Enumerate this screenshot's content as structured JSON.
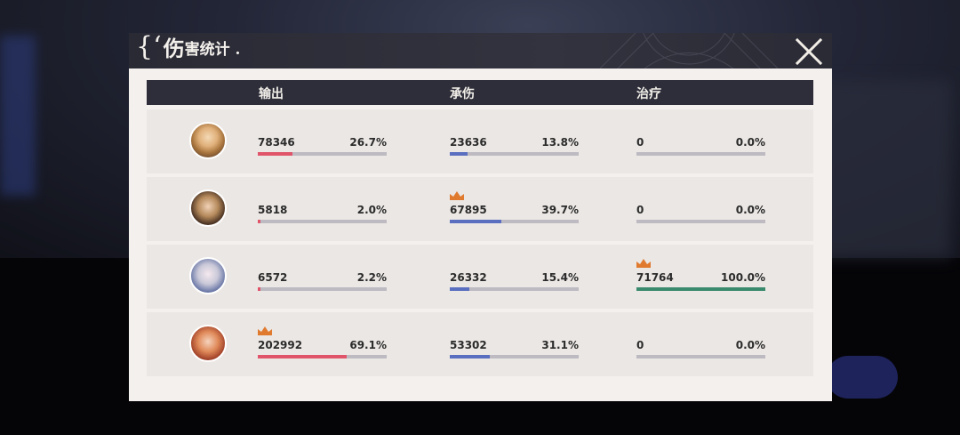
{
  "window": {
    "title_brace": "{‘",
    "title_big": "伤",
    "title_rest": "害统计 ."
  },
  "columns": [
    "输出",
    "承伤",
    "治疗"
  ],
  "colors": {
    "output": "#e0556a",
    "damage_taken": "#5a6fc0",
    "healing": "#3a8a6e",
    "crown": "#e07a2e"
  },
  "rows": [
    {
      "avatar": "character-1-avatar",
      "output": {
        "value": "78346",
        "pct": "26.7%",
        "ratio": 0.267
      },
      "taken": {
        "value": "23636",
        "pct": "13.8%",
        "ratio": 0.138
      },
      "healing": {
        "value": "0",
        "pct": "0.0%",
        "ratio": 0.0
      }
    },
    {
      "avatar": "character-2-avatar",
      "output": {
        "value": "5818",
        "pct": "2.0%",
        "ratio": 0.02
      },
      "taken": {
        "value": "67895",
        "pct": "39.7%",
        "ratio": 0.397,
        "crown": true
      },
      "healing": {
        "value": "0",
        "pct": "0.0%",
        "ratio": 0.0
      }
    },
    {
      "avatar": "character-3-avatar",
      "output": {
        "value": "6572",
        "pct": "2.2%",
        "ratio": 0.022
      },
      "taken": {
        "value": "26332",
        "pct": "15.4%",
        "ratio": 0.154
      },
      "healing": {
        "value": "71764",
        "pct": "100.0%",
        "ratio": 1.0,
        "crown": true
      }
    },
    {
      "avatar": "character-4-avatar",
      "output": {
        "value": "202992",
        "pct": "69.1%",
        "ratio": 0.691,
        "crown": true
      },
      "taken": {
        "value": "53302",
        "pct": "31.1%",
        "ratio": 0.311
      },
      "healing": {
        "value": "0",
        "pct": "0.0%",
        "ratio": 0.0
      }
    }
  ]
}
